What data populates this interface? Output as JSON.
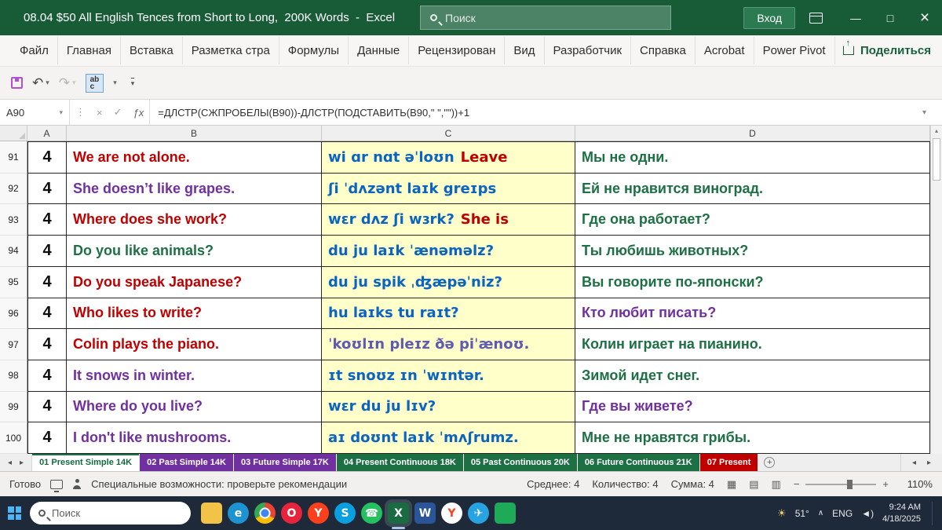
{
  "colors": {
    "red": "#c00000",
    "purple": "#7030a0",
    "green": "#1d7044",
    "blue": "#0a64c2",
    "violet": "#5f5bb0",
    "dark": "#111111"
  },
  "title_bar": {
    "title": "08.04 $50 All English Tences from Short to Long,  200K Words  -  Excel",
    "search_placeholder": "Поиск",
    "signin": "Вход"
  },
  "ribbon": {
    "tabs": [
      "Файл",
      "Главная",
      "Вставка",
      "Разметка стра",
      "Формулы",
      "Данные",
      "Рецензирован",
      "Вид",
      "Разработчик",
      "Справка",
      "Acrobat",
      "Power Pivot"
    ],
    "share": "Поделиться",
    "abc_top": "ab",
    "abc_bottom": "c"
  },
  "formula_bar": {
    "cell_ref": "A90",
    "formula": "=ДЛСТР(СЖПРОБЕЛЫ(B90))-ДЛСТР(ПОДСТАВИТЬ(B90,\" \",\"\"))+1"
  },
  "grid": {
    "column_headers": [
      "A",
      "B",
      "C",
      "D"
    ],
    "rows": [
      {
        "num": "91",
        "a": "4",
        "b": {
          "text": "We are not alone.",
          "color": "red"
        },
        "c": {
          "text": "wi ɑr nɑt əˈloʊn",
          "color": "blue",
          "suffix": "Leave",
          "suffix_color": "red"
        },
        "d": {
          "text": "Мы не одни.",
          "color": "green"
        }
      },
      {
        "num": "92",
        "a": "4",
        "b": {
          "text": "She doesn’t like grapes.",
          "color": "purple"
        },
        "c": {
          "text": "ʃi ˈdʌzənt laɪk greɪps",
          "color": "blue"
        },
        "d": {
          "text": "Ей не нравится виноград.",
          "color": "green"
        }
      },
      {
        "num": "93",
        "a": "4",
        "b": {
          "text": "Where does she work?",
          "color": "red"
        },
        "c": {
          "text": "wɛr dʌz ʃi wɜrk?",
          "color": "blue",
          "suffix": "She is",
          "suffix_color": "red"
        },
        "d": {
          "text": "Где она работает?",
          "color": "green"
        }
      },
      {
        "num": "94",
        "a": "4",
        "b": {
          "text": "Do you like animals?",
          "color": "green"
        },
        "c": {
          "text": "du ju laɪk ˈænəməlz?",
          "color": "blue"
        },
        "d": {
          "text": "Ты любишь животных?",
          "color": "green"
        }
      },
      {
        "num": "95",
        "a": "4",
        "b": {
          "text": "Do you speak Japanese?",
          "color": "red"
        },
        "c": {
          "text": "du ju spik ˌʤæpəˈniz?",
          "color": "blue"
        },
        "d": {
          "text": "Вы говорите по-японски?",
          "color": "green"
        }
      },
      {
        "num": "96",
        "a": "4",
        "b": {
          "text": "Who likes to write?",
          "color": "red"
        },
        "c": {
          "text": "hu laɪks tu raɪt?",
          "color": "blue"
        },
        "d": {
          "text": "Кто любит писать?",
          "color": "purple"
        }
      },
      {
        "num": "97",
        "a": "4",
        "b": {
          "text": "Colin plays the piano.",
          "color": "red"
        },
        "c": {
          "text": "ˈkoʊlɪn pleɪz ðə piˈænoʊ.",
          "color": "violet"
        },
        "d": {
          "text": "Колин играет на пианино.",
          "color": "green"
        }
      },
      {
        "num": "98",
        "a": "4",
        "b": {
          "text": "It snows in winter.",
          "color": "purple"
        },
        "c": {
          "text": "ɪt snoʊz ɪn ˈwɪntər.",
          "color": "blue"
        },
        "d": {
          "text": "Зимой идет снег.",
          "color": "green"
        }
      },
      {
        "num": "99",
        "a": "4",
        "b": {
          "text": "Where do you live?",
          "color": "purple"
        },
        "c": {
          "text": "wɛr du ju lɪv?",
          "color": "blue"
        },
        "d": {
          "text": "Где вы живете?",
          "color": "purple"
        }
      },
      {
        "num": "100",
        "a": "4",
        "b": {
          "text": "I don't like mushrooms.",
          "color": "purple"
        },
        "c": {
          "text": "aɪ doʊnt laɪk ˈmʌʃrumz.",
          "color": "blue"
        },
        "d": {
          "text": "Мне не нравятся грибы.",
          "color": "green"
        }
      }
    ]
  },
  "sheet_tabs": [
    {
      "label": "01 Present Simple 14K",
      "type": "active"
    },
    {
      "label": "02 Past Simple 14K",
      "type": "purple"
    },
    {
      "label": "03 Future Simple 17K",
      "type": "purple"
    },
    {
      "label": "04 Present Continuous 18K",
      "type": "green"
    },
    {
      "label": "05 Past Continuous 20K",
      "type": "green"
    },
    {
      "label": "06 Future Continuous 21K",
      "type": "green"
    },
    {
      "label": "07 Present",
      "type": "red"
    }
  ],
  "status_bar": {
    "ready": "Готово",
    "accessibility": "Специальные возможности: проверьте рекомендации",
    "avg": "Среднее: 4",
    "count": "Количество: 4",
    "sum": "Сумма: 4",
    "zoom": "110%"
  },
  "taskbar": {
    "search_placeholder": "Поиск",
    "icons": [
      {
        "name": "file-explorer",
        "label": "",
        "bg": "#f2c347",
        "shape": "square"
      },
      {
        "name": "edge",
        "label": "e",
        "bg": "#1d93d2",
        "shape": "circle"
      },
      {
        "name": "chrome",
        "label": "",
        "bg": "",
        "shape": "circle"
      },
      {
        "name": "opera",
        "label": "O",
        "bg": "#e8243c",
        "shape": "circle"
      },
      {
        "name": "yandex-browser",
        "label": "Y",
        "bg": "#fc3f1d",
        "shape": "circle"
      },
      {
        "name": "skype",
        "label": "S",
        "bg": "#0aa0e0",
        "shape": "circle"
      },
      {
        "name": "whatsapp",
        "label": "☎",
        "bg": "#23c25f",
        "shape": "circle"
      },
      {
        "name": "excel",
        "label": "X",
        "bg": "#1a6b42",
        "shape": "square",
        "active": true
      },
      {
        "name": "word",
        "label": "W",
        "bg": "#2a5699",
        "shape": "square"
      },
      {
        "name": "yandex-start",
        "label": "Y",
        "bg": "#ffffff",
        "fg": "#fc3f1d",
        "shape": "circle"
      },
      {
        "name": "telegram",
        "label": "✈",
        "bg": "#27a3e2",
        "shape": "circle"
      },
      {
        "name": "green-app",
        "label": "",
        "bg": "#1faa59",
        "shape": "square"
      }
    ],
    "tray": {
      "weather": "51°",
      "lang": "ENG",
      "time": "9:24 AM",
      "date": "4/18/2025"
    }
  },
  "glyphs": {
    "minimize": "—",
    "maximize": "□",
    "close": "×",
    "undo": "↶",
    "redo": "↷",
    "caret": "▾",
    "kebab": "⋮",
    "cancel": "×",
    "enter": "✓",
    "fx": "ƒx",
    "nav_left": "◂",
    "nav_right": "▸",
    "plus": "+",
    "minus": "−",
    "sun": "☀",
    "chevron": "∧",
    "volume": "◄)",
    "view_normal": "▦",
    "view_layout": "▤",
    "view_break": "▥"
  }
}
